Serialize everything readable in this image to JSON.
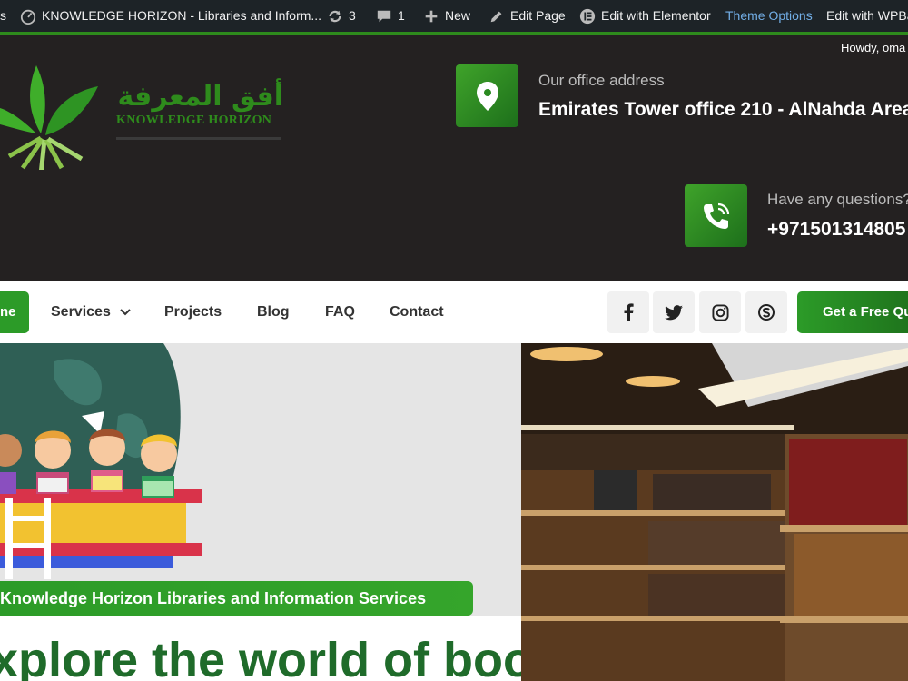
{
  "admin_bar": {
    "leading": "s",
    "site_name": "KNOWLEDGE HORIZON - Libraries and Inform...",
    "updates_count": "3",
    "comments_count": "1",
    "new_label": "New",
    "edit_page_label": "Edit Page",
    "elementor_label": "Edit with Elementor",
    "theme_options_label": "Theme Options",
    "wpbakery_label": "Edit with WPBa",
    "howdy": "Howdy, oma"
  },
  "header": {
    "logo_arabic": "أفق المعرفة",
    "logo_english": "KNOWLEDGE HORIZON",
    "address_label": "Our office address",
    "address_value": "Emirates Tower office 210 - AlNahda Area",
    "questions_label": "Have any questions?",
    "phone_value": "+971501314805"
  },
  "nav": {
    "home_fragment": "ne",
    "services": "Services",
    "projects": "Projects",
    "blog": "Blog",
    "faq": "FAQ",
    "contact": "Contact",
    "quote_button": "Get a Free Quo"
  },
  "hero": {
    "tagline": "Knowledge Horizon Libraries and Information Services",
    "title": "xplore the world of books"
  },
  "colors": {
    "admin_bg": "#1d2327",
    "brand_green": "#2c9b28",
    "header_bg": "#242121",
    "title_green": "#1f6b2a"
  }
}
